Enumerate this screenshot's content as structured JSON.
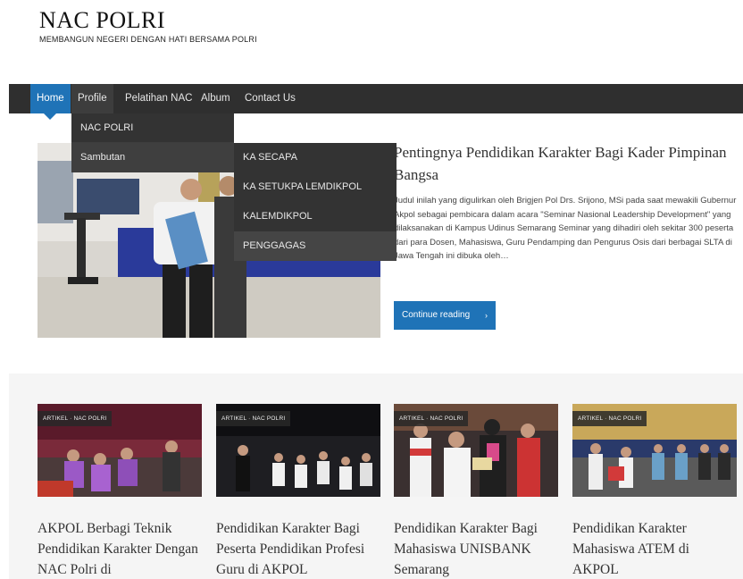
{
  "site": {
    "title": "NAC POLRI",
    "tagline": "MEMBANGUN NEGERI DENGAN HATI BERSAMA POLRI"
  },
  "nav": {
    "items": [
      {
        "label": "Home"
      },
      {
        "label": "Profile"
      },
      {
        "label": "Pelatihan NAC"
      },
      {
        "label": "Album"
      },
      {
        "label": "Contact Us"
      }
    ],
    "dropdown": [
      {
        "label": "NAC POLRI"
      },
      {
        "label": "Sambutan"
      }
    ],
    "submenu": [
      {
        "label": "KA SECAPA"
      },
      {
        "label": "KA SETUKPA LEMDIKPOL"
      },
      {
        "label": "KALEMDIKPOL"
      },
      {
        "label": "PENGGAGAS"
      }
    ]
  },
  "featured": {
    "title": "Pentingnya Pendidikan Karakter Bagi Kader Pimpinan Bangsa",
    "excerpt": "Judul inilah yang digulirkan oleh Brigjen Pol Drs. Srijono, MSi pada saat mewakili Gubernur Akpol sebagai pembicara dalam acara \"Seminar Nasional Leadership Development\" yang dilaksanakan di Kampus Udinus Semarang Seminar yang dihadiri oleh sekitar 300 peserta dari para Dosen, Mahasiswa, Guru Pendamping dan Pengurus Osis dari berbagai SLTA di Jawa Tengah ini dibuka oleh…",
    "button_label": "Continue reading",
    "button_arrow": "›"
  },
  "cards": [
    {
      "badge": "ARTIKEL · NAC POLRI",
      "title": "AKPOL Berbagi Teknik Pendidikan Karakter Dengan NAC Polri di"
    },
    {
      "badge": "ARTIKEL · NAC POLRI",
      "title": "Pendidikan Karakter Bagi Peserta Pendidikan Profesi Guru di AKPOL"
    },
    {
      "badge": "ARTIKEL · NAC POLRI",
      "title": "Pendidikan Karakter Bagi Mahasiswa UNISBANK Semarang"
    },
    {
      "badge": "ARTIKEL · NAC POLRI",
      "title": "Pendidikan Karakter Mahasiswa ATEM di AKPOL"
    }
  ],
  "colors": {
    "accent": "#1f73b7",
    "navbar": "#2f2f2f",
    "dropdown": "#333333"
  }
}
